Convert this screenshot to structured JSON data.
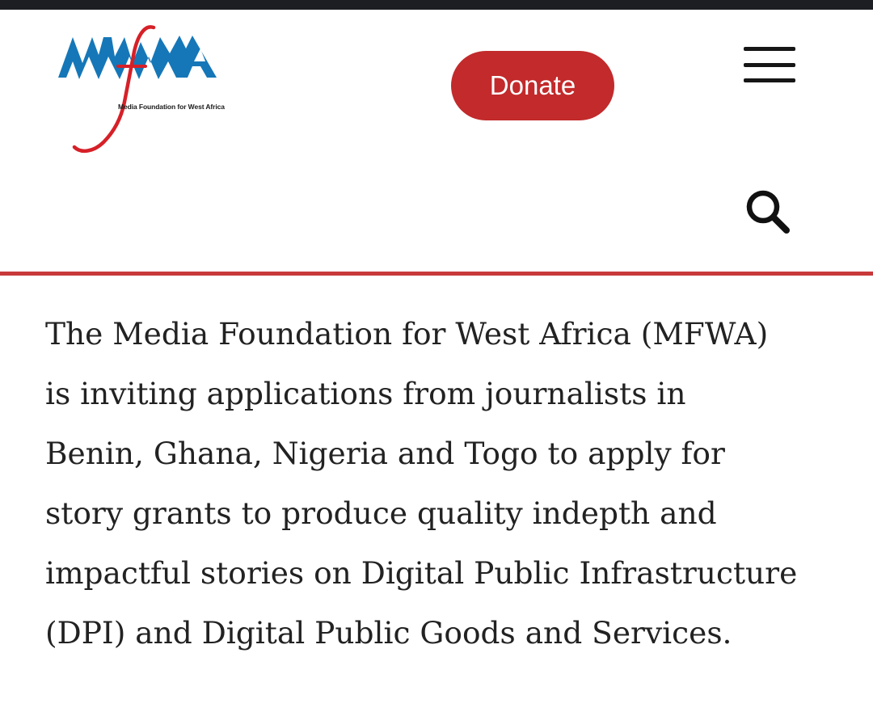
{
  "header": {
    "logo": {
      "wordmark": "MFWA",
      "tagline": "Media Foundation for West Africa"
    },
    "donate_label": "Donate",
    "menu_icon": "hamburger-menu-icon",
    "search_icon": "search-icon"
  },
  "colors": {
    "status_bar": "#1d1e24",
    "accent_red": "#c22a2b",
    "logo_blue": "#1577b8",
    "divider_red": "#c8393a",
    "body_text": "#222222"
  },
  "article": {
    "intro_text": "The Media Foundation for West Africa (MFWA)\nis inviting applications from journalists in\nBenin, Ghana, Nigeria and Togo to apply for\nstory grants to produce quality indepth and\nimpactful stories on Digital Public Infrastructure\n(DPI) and Digital Public Goods and Services."
  }
}
